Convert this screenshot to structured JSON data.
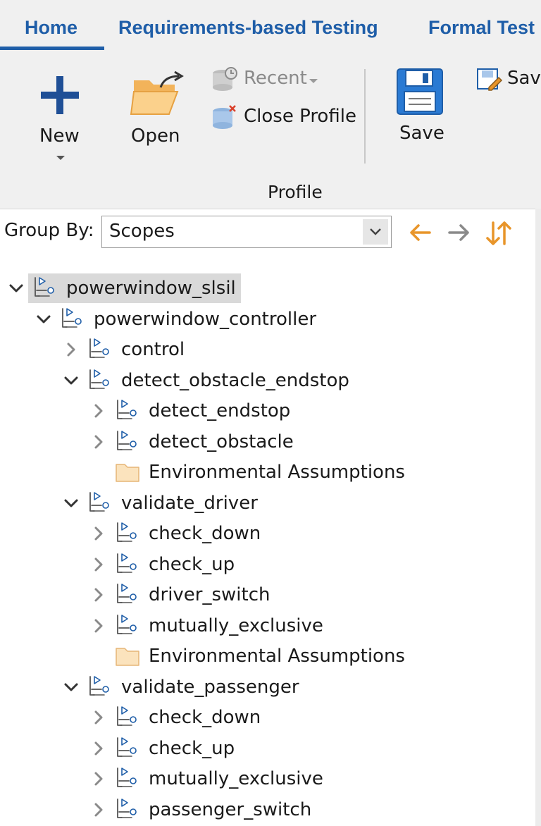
{
  "tabs": [
    {
      "label": "Home",
      "active": true
    },
    {
      "label": "Requirements-based Testing",
      "active": false
    },
    {
      "label": "Formal Test",
      "active": false
    }
  ],
  "ribbon": {
    "new_label": "New",
    "open_label": "Open",
    "recent_label": "Recent",
    "close_profile_label": "Close Profile",
    "save_label": "Save",
    "save_as_label": "Sav",
    "group_label": "Profile"
  },
  "groupby": {
    "label": "Group By:",
    "value": "Scopes"
  },
  "colors": {
    "accent": "#1f5ea8",
    "orange_arrow": "#e8952a",
    "gray_arrow": "#8a8a8a",
    "folder": "#fbe3bd"
  },
  "tree": [
    {
      "label": "powerwindow_slsil",
      "depth": 0,
      "state": "expanded",
      "icon": "scope-icon",
      "selected": true
    },
    {
      "label": "powerwindow_controller",
      "depth": 1,
      "state": "expanded",
      "icon": "scope-icon"
    },
    {
      "label": "control",
      "depth": 2,
      "state": "collapsed",
      "icon": "scope-icon"
    },
    {
      "label": "detect_obstacle_endstop",
      "depth": 2,
      "state": "expanded",
      "icon": "scope-icon"
    },
    {
      "label": "detect_endstop",
      "depth": 3,
      "state": "collapsed",
      "icon": "scope-icon"
    },
    {
      "label": "detect_obstacle",
      "depth": 3,
      "state": "collapsed",
      "icon": "scope-icon"
    },
    {
      "label": "Environmental Assumptions",
      "depth": 3,
      "state": "leaf",
      "icon": "folder-icon"
    },
    {
      "label": "validate_driver",
      "depth": 2,
      "state": "expanded",
      "icon": "scope-icon"
    },
    {
      "label": "check_down",
      "depth": 3,
      "state": "collapsed",
      "icon": "scope-icon"
    },
    {
      "label": "check_up",
      "depth": 3,
      "state": "collapsed",
      "icon": "scope-icon"
    },
    {
      "label": "driver_switch",
      "depth": 3,
      "state": "collapsed",
      "icon": "scope-icon"
    },
    {
      "label": "mutually_exclusive",
      "depth": 3,
      "state": "collapsed",
      "icon": "scope-icon"
    },
    {
      "label": "Environmental Assumptions",
      "depth": 3,
      "state": "leaf",
      "icon": "folder-icon"
    },
    {
      "label": "validate_passenger",
      "depth": 2,
      "state": "expanded",
      "icon": "scope-icon"
    },
    {
      "label": "check_down",
      "depth": 3,
      "state": "collapsed",
      "icon": "scope-icon"
    },
    {
      "label": "check_up",
      "depth": 3,
      "state": "collapsed",
      "icon": "scope-icon"
    },
    {
      "label": "mutually_exclusive",
      "depth": 3,
      "state": "collapsed",
      "icon": "scope-icon"
    },
    {
      "label": "passenger_switch",
      "depth": 3,
      "state": "collapsed",
      "icon": "scope-icon"
    }
  ]
}
